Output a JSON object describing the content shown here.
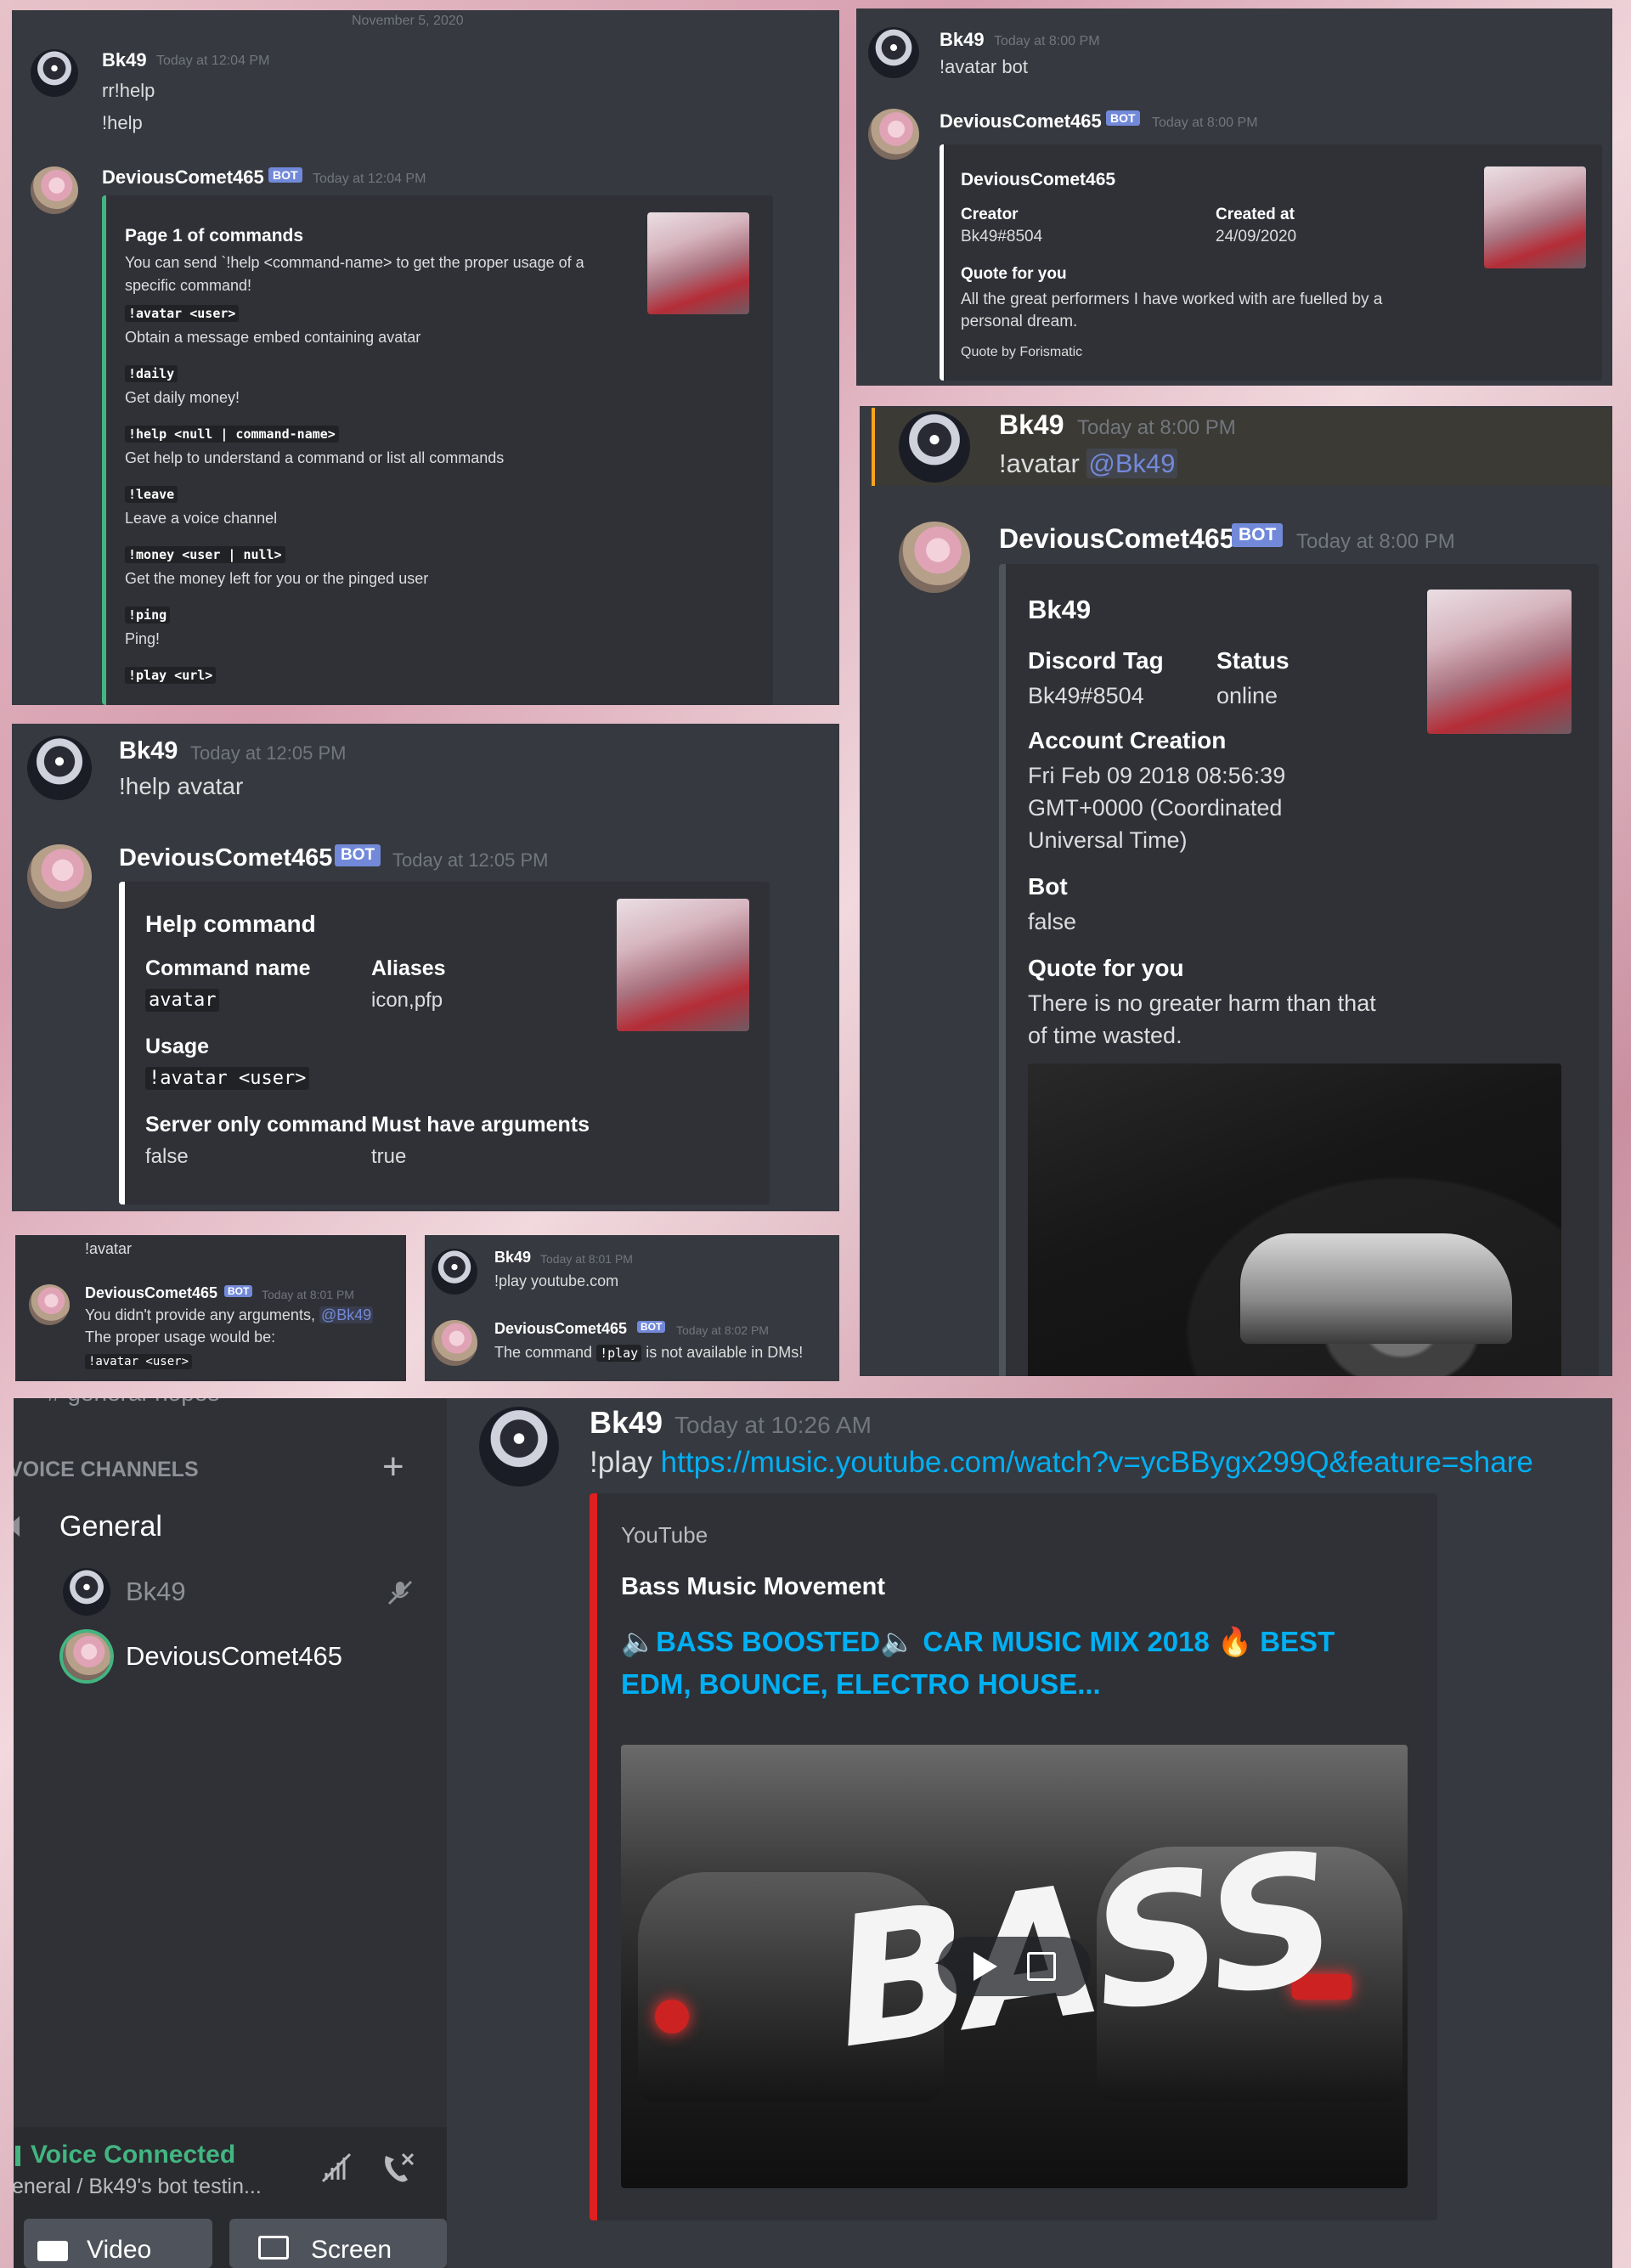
{
  "colors": {
    "bot_tag": "#7289da",
    "embed_green": "#43b581",
    "embed_white": "#ffffff",
    "embed_gray": "#4f545c",
    "embed_red": "#e02020",
    "link": "#00b0f4",
    "voice_green": "#43b581"
  },
  "p1": {
    "date_divider": "November 5, 2020",
    "user_msg": {
      "name": "Bk49",
      "time": "Today at 12:04 PM",
      "line1": "rr!help",
      "line2": "!help"
    },
    "bot_msg": {
      "name": "DeviousComet465",
      "tag": "BOT",
      "time": "Today at 12:04 PM",
      "embed": {
        "title": "Page 1 of commands",
        "desc": "You can send `!help <command-name> to get the proper usage of a specific command!",
        "commands": [
          {
            "cmd": "!avatar <user>",
            "desc": "Obtain a message embed containing avatar"
          },
          {
            "cmd": "!daily",
            "desc": "Get daily money!"
          },
          {
            "cmd": "!help <null | command-name>",
            "desc": "Get help to understand a command or list all commands"
          },
          {
            "cmd": "!leave",
            "desc": "Leave a voice channel"
          },
          {
            "cmd": "!money <user | null>",
            "desc": "Get the money left for you or the pinged user"
          },
          {
            "cmd": "!ping",
            "desc": "Ping!"
          },
          {
            "cmd": "!play <url>",
            "desc": ""
          }
        ]
      }
    }
  },
  "p2": {
    "user_msg": {
      "name": "Bk49",
      "time": "Today at 8:00 PM",
      "text": "!avatar bot"
    },
    "bot_msg": {
      "name": "DeviousComet465",
      "tag": "BOT",
      "time": "Today at 8:00 PM",
      "embed": {
        "title": "DeviousComet465",
        "creator_label": "Creator",
        "creator_value": "Bk49#8504",
        "created_label": "Created at",
        "created_value": "24/09/2020",
        "quote_label": "Quote for you",
        "quote_text": "All the great performers I have worked with are fuelled by a personal dream.",
        "footer": "Quote by Forismatic"
      }
    }
  },
  "p3": {
    "user_msg": {
      "name": "Bk49",
      "time": "Today at 12:05 PM",
      "text": "!help avatar"
    },
    "bot_msg": {
      "name": "DeviousComet465",
      "tag": "BOT",
      "time": "Today at 12:05 PM",
      "embed": {
        "title": "Help command",
        "cmdname_label": "Command name",
        "cmdname_value": "avatar",
        "aliases_label": "Aliases",
        "aliases_value": "icon,pfp",
        "usage_label": "Usage",
        "usage_value": "!avatar <user>",
        "server_label": "Server only command",
        "server_value": "false",
        "args_label": "Must have arguments",
        "args_value": "true"
      }
    }
  },
  "p4": {
    "user_msg": {
      "name": "Bk49",
      "time": "Today at 8:00 PM",
      "prefix": "!avatar ",
      "mention": "@Bk49"
    },
    "bot_msg": {
      "name": "DeviousComet465",
      "tag": "BOT",
      "time": "Today at 8:00 PM",
      "embed": {
        "title": "Bk49",
        "tag_label": "Discord Tag",
        "tag_value": "Bk49#8504",
        "status_label": "Status",
        "status_value": "online",
        "acct_label": "Account Creation",
        "acct_l1": "Fri Feb 09 2018 08:56:39",
        "acct_l2": "GMT+0000 (Coordinated",
        "acct_l3": "Universal Time)",
        "bot_label": "Bot",
        "bot_value": "false",
        "quote_label": "Quote for you",
        "quote_l1": "There is no greater harm than that",
        "quote_l2": "of time wasted."
      }
    }
  },
  "p5": {
    "user_text": "!avatar",
    "bot_msg": {
      "name": "DeviousComet465",
      "tag": "BOT",
      "time": "Today at 8:01 PM",
      "line1": "You didn't provide any arguments, ",
      "mention": "@Bk49",
      "line2": "The proper usage would be:",
      "code": "!avatar <user>"
    }
  },
  "p6": {
    "user_msg": {
      "name": "Bk49",
      "time": "Today at 8:01 PM",
      "text": "!play youtube.com"
    },
    "bot_msg": {
      "name": "DeviousComet465",
      "tag": "BOT",
      "time": "Today at 8:02 PM",
      "pre": "The command ",
      "code": "!play",
      "post": " is not available in DMs!"
    }
  },
  "p7": {
    "sidebar": {
      "cut_text": "# general-hopes",
      "voice_header": "VOICE CHANNELS",
      "add_icon": "+",
      "channel": "General",
      "members": [
        {
          "name": "Bk49",
          "status": "muted"
        },
        {
          "name": "DeviousComet465",
          "status": "speaking"
        }
      ],
      "voice_status": "Voice Connected",
      "voice_channel": "eneral / Bk49's bot testin...",
      "btn_video": "Video",
      "btn_screen": "Screen"
    },
    "user_msg": {
      "name": "Bk49",
      "time": "Today at 10:26 AM",
      "prefix": "!play ",
      "url": "https://music.youtube.com/watch?v=ycBBygx299Q&feature=share"
    },
    "embed": {
      "provider": "YouTube",
      "author": "Bass Music Movement",
      "title_l1": "🔈BASS BOOSTED🔈 CAR MUSIC MIX 2018 🔥 BEST",
      "title_l2": "EDM, BOUNCE, ELECTRO HOUSE...",
      "video_overlay": "BASS"
    }
  }
}
